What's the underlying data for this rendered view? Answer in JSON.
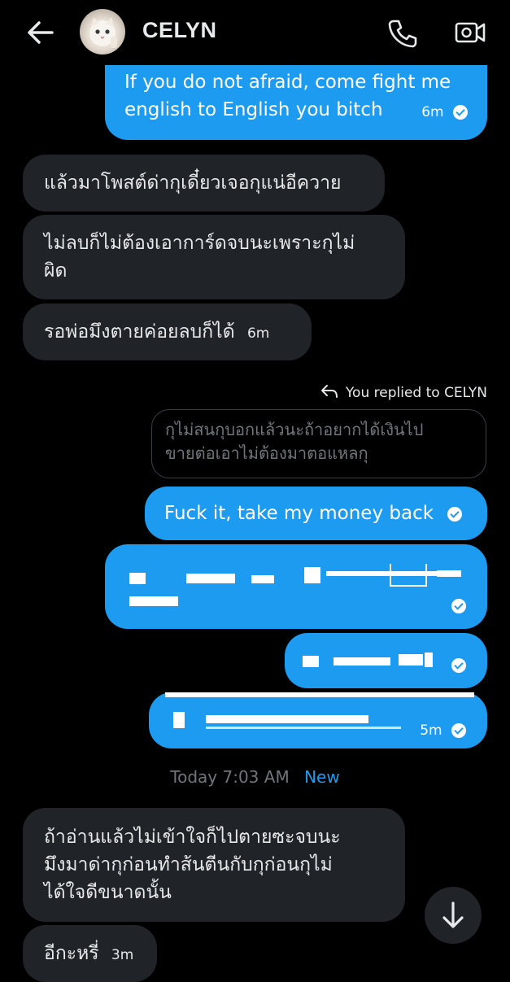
{
  "header": {
    "title": "CELYN",
    "back_icon": "arrow-left-icon",
    "avatar": "cat-avatar",
    "call_icon": "phone-icon",
    "video_icon": "video-camera-icon"
  },
  "messages": [
    {
      "side": "out",
      "line1": "If you do not afraid, come fight me",
      "line2": "english to English you bitch",
      "time": "6m"
    },
    {
      "side": "in",
      "text": "แล้วมาโพสต์ด่ากุเดี๋ยวเจอกุแน่อีควาย"
    },
    {
      "side": "in",
      "line1": "ไม่ลบก็ไม่ต้องเอาการ์ดจบนะเพราะกุไม่",
      "line2": "ผิด"
    },
    {
      "side": "in",
      "text": "รอพ่อมึงตายค่อยลบก็ได้",
      "time": "6m"
    },
    {
      "side": "out",
      "text": "Fuck it, take my money back"
    },
    {
      "side": "out",
      "text": "",
      "blurred": true
    },
    {
      "side": "out",
      "text": "",
      "blurred": true
    },
    {
      "side": "out",
      "text": "",
      "blurred": true,
      "time": "5m"
    },
    {
      "side": "in",
      "line1": "ถ้าอ่านแล้วไม่เข้าใจก็ไปตายซะจบนะ",
      "line2": "มึงมาด่ากุก่อนทำส้นตีนกับกุก่อนกุไม่",
      "line3": "ได้ใจดีขนาดนั้น"
    },
    {
      "side": "in",
      "text": "อีกะหรี่",
      "time": "3m"
    }
  ],
  "reply": {
    "label": "You replied to CELYN",
    "quote_line1": "กุไม่สนกุบอกแล้วนะถ้าอยากได้เงินไป",
    "quote_line2": "ขายต่อเอาไม่ต้องมาตอแหลกุ"
  },
  "separator": {
    "time": "Today 7:03 AM",
    "new_label": "New"
  },
  "scroll_button_icon": "arrow-down-icon",
  "colors": {
    "accent": "#1d9bf0",
    "incoming": "#202327",
    "background": "#000000"
  }
}
